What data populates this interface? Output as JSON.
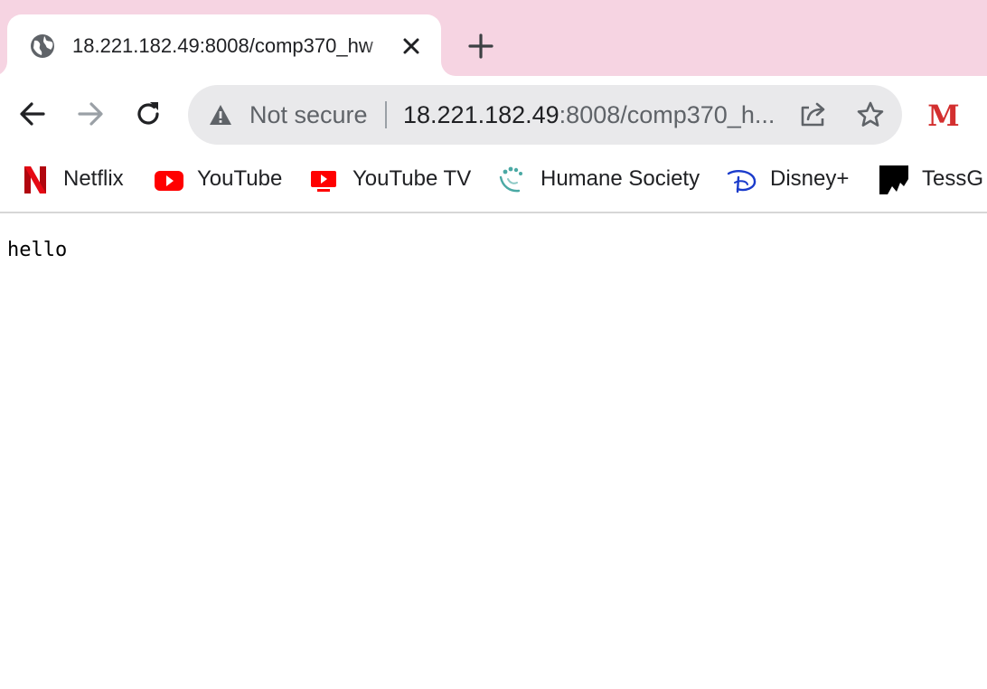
{
  "tab": {
    "title": "18.221.182.49:8008/comp370_hw",
    "favicon": "globe-icon",
    "close_icon": "close-icon"
  },
  "new_tab_icon": "plus-icon",
  "toolbar": {
    "back_icon": "back-arrow-icon",
    "forward_icon": "forward-arrow-icon",
    "reload_icon": "reload-icon",
    "security_label": "Not secure",
    "url_host": "18.221.182.49",
    "url_rest": ":8008/comp370_h...",
    "share_icon": "share-icon",
    "star_icon": "star-icon",
    "profile_letter": "M"
  },
  "bookmarks": [
    {
      "label": "Netflix",
      "icon": "netflix-icon"
    },
    {
      "label": "YouTube",
      "icon": "youtube-icon"
    },
    {
      "label": "YouTube TV",
      "icon": "youtube-tv-icon"
    },
    {
      "label": "Humane Society",
      "icon": "humane-society-icon"
    },
    {
      "label": "Disney+",
      "icon": "disney-plus-icon"
    },
    {
      "label": "TessG |",
      "icon": "tessg-icon"
    }
  ],
  "page": {
    "text": "hello"
  },
  "colors": {
    "tab_strip": "#f6d4e2",
    "omnibox": "#e9e9eb",
    "netflix_red": "#e50914",
    "youtube_red": "#ff0000",
    "disney_blue": "#1a3bcb",
    "humane_teal": "#4aa9a4",
    "profile_red": "#d32f2f"
  }
}
